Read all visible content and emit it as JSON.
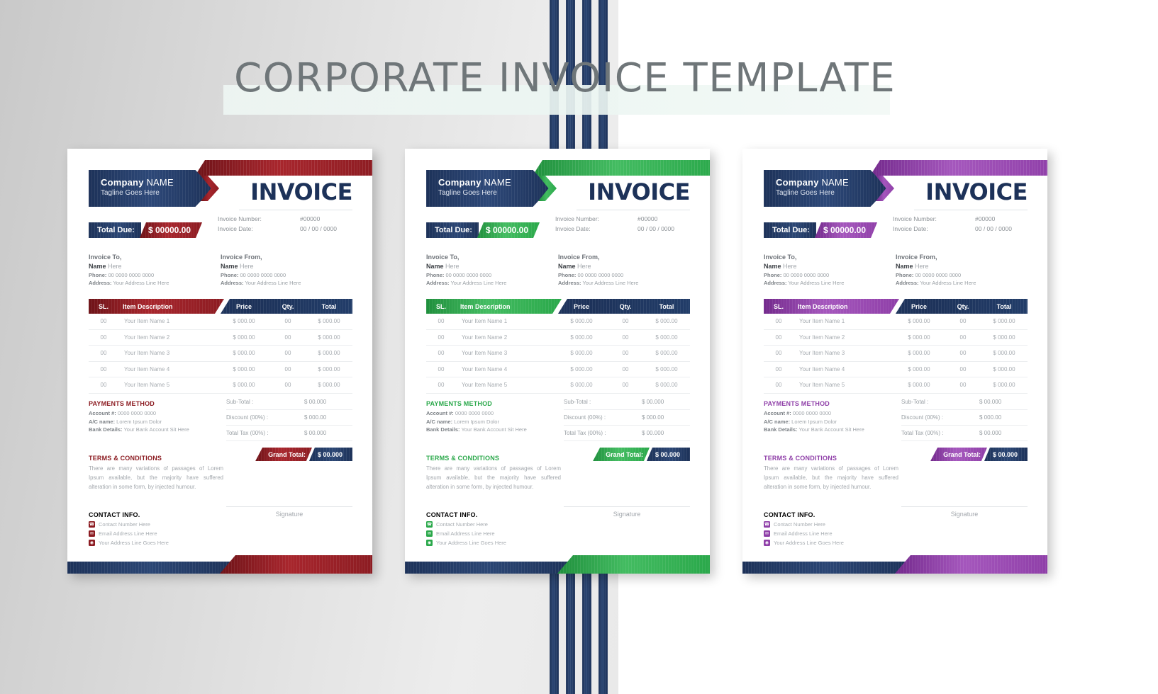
{
  "page": {
    "title": "CORPORATE INVOICE TEMPLATE",
    "background_left": "#dcdcdc",
    "background_right": "#ffffff",
    "stripe_color": "#1d3259",
    "stripe_count": 4
  },
  "common": {
    "company_name_bold": "Company",
    "company_name_rest": " NAME",
    "tagline": "Tagline Goes Here",
    "invoice_word": "INVOICE",
    "meta": [
      {
        "label": "Invoice Number:",
        "value": "#00000"
      },
      {
        "label": "Invoice Date:",
        "value": "00 / 00 / 0000"
      }
    ],
    "total_due_label": "Total Due:",
    "total_due_value": "$ 00000.00",
    "invoice_to": {
      "heading": "Invoice To,",
      "name_bold": "Name",
      "name_rest": " Here",
      "phone_label": "Phone:",
      "phone_value": " 00 0000 0000 0000",
      "address_label": "Address:",
      "address_value": " Your Address Line Here"
    },
    "invoice_from": {
      "heading": "Invoice From,",
      "name_bold": "Name",
      "name_rest": " Here",
      "phone_label": "Phone:",
      "phone_value": " 00 0000 0000 0000",
      "address_label": "Address:",
      "address_value": " Your Address Line Here"
    },
    "table": {
      "headers": [
        "SL.",
        "Item Description",
        "Price",
        "Qty.",
        "Total"
      ],
      "rows": [
        {
          "sl": "00",
          "desc": "Your Item Name 1",
          "price": "$ 000.00",
          "qty": "00",
          "total": "$ 000.00"
        },
        {
          "sl": "00",
          "desc": "Your Item Name 2",
          "price": "$ 000.00",
          "qty": "00",
          "total": "$ 000.00"
        },
        {
          "sl": "00",
          "desc": "Your Item Name 3",
          "price": "$ 000.00",
          "qty": "00",
          "total": "$ 000.00"
        },
        {
          "sl": "00",
          "desc": "Your Item Name 4",
          "price": "$ 000.00",
          "qty": "00",
          "total": "$ 000.00"
        },
        {
          "sl": "00",
          "desc": "Your Item Name 5",
          "price": "$ 000.00",
          "qty": "00",
          "total": "$ 000.00"
        }
      ]
    },
    "summary": [
      {
        "label": "Sub-Total :",
        "value": "$ 00.000"
      },
      {
        "label": "Discount (00%) :",
        "value": "$ 000.00"
      },
      {
        "label": "Total Tax (00%) :",
        "value": "$ 00.000"
      }
    ],
    "grand_total_label": "Grand Total:",
    "grand_total_value": "$ 00.000",
    "payments": {
      "title": "PAYMENTS METHOD",
      "account_label": "Account #:",
      "account_value": " 0000 0000 0000",
      "ac_name_label": "A/C name:",
      "ac_name_value": " Lorem Ipsum Dolor",
      "bank_label": "Bank Details:",
      "bank_value": " Your Bank Account Sit Here"
    },
    "terms": {
      "title": "TERMS & CONDITIONS",
      "text": "There are many variations of passages of Lorem Ipsum available, but the majority have suffered alteration in some form, by injected humour."
    },
    "signature_label": "Signature",
    "contact": {
      "title": "CONTACT INFO.",
      "items": [
        {
          "icon": "phone-icon",
          "glyph": "☎",
          "text": "Contact Number Here"
        },
        {
          "icon": "email-icon",
          "glyph": "✉",
          "text": "Email Address Line Here"
        },
        {
          "icon": "location-pin-icon",
          "glyph": "◉",
          "text": "Your Address Line Goes Here"
        }
      ]
    }
  },
  "cards": [
    {
      "id": "card-red",
      "variant": "red",
      "accent": "#8c1c22",
      "accent_light": "#a8262d",
      "accent_dark": "#6e1318",
      "navy": "#1d3259"
    },
    {
      "id": "card-green",
      "variant": "green",
      "accent": "#2aa84a",
      "accent_light": "#43bc61",
      "accent_dark": "#1f8f3c",
      "navy": "#1d3259"
    },
    {
      "id": "card-purple",
      "variant": "purple",
      "accent": "#8f3fa8",
      "accent_light": "#a557bd",
      "accent_dark": "#73298c",
      "navy": "#1d3259"
    }
  ]
}
